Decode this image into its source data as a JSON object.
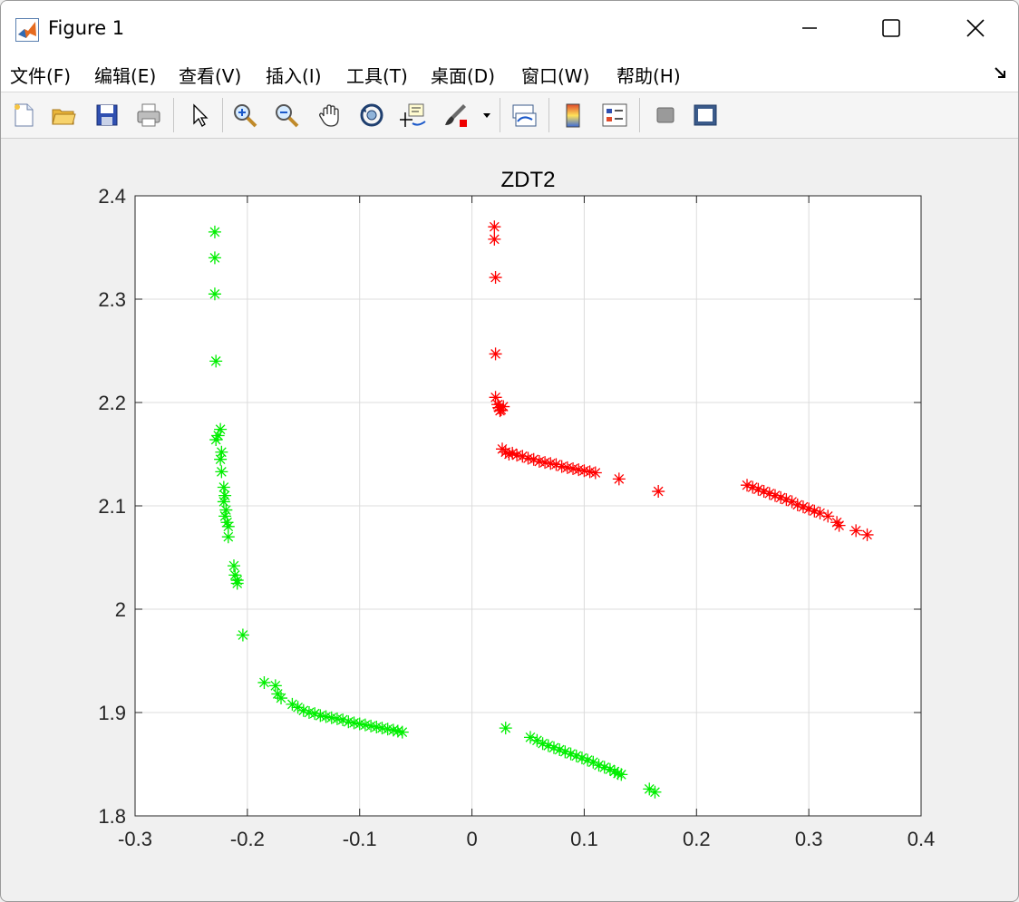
{
  "window": {
    "title": "Figure 1"
  },
  "menu": {
    "items": [
      "文件(F)",
      "编辑(E)",
      "查看(V)",
      "插入(I)",
      "工具(T)",
      "桌面(D)",
      "窗口(W)",
      "帮助(H)"
    ]
  },
  "toolbar": {
    "buttons": [
      "new-figure-icon",
      "open-file-icon",
      "save-icon",
      "print-icon",
      "select-arrow-icon",
      "zoom-in-icon",
      "zoom-out-icon",
      "pan-hand-icon",
      "rotate-3d-icon",
      "data-cursor-icon",
      "brush-icon",
      "link-plot-icon",
      "colorbar-icon",
      "legend-icon",
      "hide-plot-tools-icon",
      "show-plot-tools-icon"
    ]
  },
  "colors": {
    "series_green": "#00ee00",
    "series_red": "#ff0000"
  },
  "chart_data": {
    "type": "scatter",
    "title": "ZDT2",
    "xlabel": "",
    "ylabel": "",
    "xlim": [
      -0.3,
      0.4
    ],
    "ylim": [
      1.8,
      2.4
    ],
    "xticks": [
      "-0.3",
      "-0.2",
      "-0.1",
      "0",
      "0.1",
      "0.2",
      "0.3",
      "0.4"
    ],
    "yticks": [
      "1.8",
      "1.9",
      "2",
      "2.1",
      "2.2",
      "2.3",
      "2.4"
    ],
    "grid": true,
    "marker": "asterisk",
    "series": [
      {
        "color": "#00ee00",
        "points": [
          [
            -0.229,
            2.365
          ],
          [
            -0.229,
            2.34
          ],
          [
            -0.229,
            2.305
          ],
          [
            -0.228,
            2.24
          ],
          [
            -0.224,
            2.174
          ],
          [
            -0.226,
            2.168
          ],
          [
            -0.228,
            2.164
          ],
          [
            -0.223,
            2.152
          ],
          [
            -0.224,
            2.145
          ],
          [
            -0.223,
            2.133
          ],
          [
            -0.221,
            2.118
          ],
          [
            -0.22,
            2.11
          ],
          [
            -0.221,
            2.104
          ],
          [
            -0.219,
            2.096
          ],
          [
            -0.22,
            2.09
          ],
          [
            -0.218,
            2.084
          ],
          [
            -0.217,
            2.08
          ],
          [
            -0.217,
            2.07
          ],
          [
            -0.212,
            2.042
          ],
          [
            -0.211,
            2.033
          ],
          [
            -0.209,
            2.028
          ],
          [
            -0.209,
            2.025
          ],
          [
            -0.204,
            1.975
          ],
          [
            -0.185,
            1.929
          ],
          [
            -0.175,
            1.926
          ],
          [
            -0.173,
            1.918
          ],
          [
            -0.17,
            1.914
          ],
          [
            -0.16,
            1.908
          ],
          [
            -0.155,
            1.905
          ],
          [
            -0.15,
            1.902
          ],
          [
            -0.145,
            1.9
          ],
          [
            -0.14,
            1.899
          ],
          [
            -0.135,
            1.897
          ],
          [
            -0.13,
            1.896
          ],
          [
            -0.125,
            1.895
          ],
          [
            -0.12,
            1.894
          ],
          [
            -0.115,
            1.893
          ],
          [
            -0.11,
            1.891
          ],
          [
            -0.105,
            1.89
          ],
          [
            -0.1,
            1.889
          ],
          [
            -0.095,
            1.888
          ],
          [
            -0.09,
            1.887
          ],
          [
            -0.085,
            1.886
          ],
          [
            -0.08,
            1.885
          ],
          [
            -0.075,
            1.884
          ],
          [
            -0.07,
            1.883
          ],
          [
            -0.066,
            1.882
          ],
          [
            -0.062,
            1.881
          ],
          [
            0.03,
            1.885
          ],
          [
            0.052,
            1.876
          ],
          [
            0.058,
            1.873
          ],
          [
            0.063,
            1.87
          ],
          [
            0.068,
            1.868
          ],
          [
            0.073,
            1.866
          ],
          [
            0.078,
            1.864
          ],
          [
            0.083,
            1.862
          ],
          [
            0.088,
            1.86
          ],
          [
            0.093,
            1.858
          ],
          [
            0.098,
            1.856
          ],
          [
            0.103,
            1.854
          ],
          [
            0.108,
            1.852
          ],
          [
            0.113,
            1.849
          ],
          [
            0.118,
            1.847
          ],
          [
            0.123,
            1.845
          ],
          [
            0.127,
            1.843
          ],
          [
            0.13,
            1.841
          ],
          [
            0.133,
            1.84
          ],
          [
            0.158,
            1.826
          ],
          [
            0.163,
            1.823
          ]
        ]
      },
      {
        "color": "#ff0000",
        "points": [
          [
            0.02,
            2.37
          ],
          [
            0.02,
            2.358
          ],
          [
            0.021,
            2.321
          ],
          [
            0.021,
            2.247
          ],
          [
            0.021,
            2.205
          ],
          [
            0.023,
            2.198
          ],
          [
            0.024,
            2.195
          ],
          [
            0.026,
            2.193
          ],
          [
            0.028,
            2.196
          ],
          [
            0.025,
            2.192
          ],
          [
            0.027,
            2.155
          ],
          [
            0.03,
            2.152
          ],
          [
            0.033,
            2.15
          ],
          [
            0.036,
            2.151
          ],
          [
            0.04,
            2.149
          ],
          [
            0.045,
            2.148
          ],
          [
            0.05,
            2.146
          ],
          [
            0.055,
            2.145
          ],
          [
            0.06,
            2.143
          ],
          [
            0.065,
            2.142
          ],
          [
            0.07,
            2.141
          ],
          [
            0.075,
            2.14
          ],
          [
            0.08,
            2.138
          ],
          [
            0.085,
            2.137
          ],
          [
            0.09,
            2.136
          ],
          [
            0.095,
            2.135
          ],
          [
            0.1,
            2.134
          ],
          [
            0.105,
            2.133
          ],
          [
            0.11,
            2.132
          ],
          [
            0.131,
            2.126
          ],
          [
            0.166,
            2.114
          ],
          [
            0.245,
            2.12
          ],
          [
            0.25,
            2.118
          ],
          [
            0.255,
            2.116
          ],
          [
            0.26,
            2.114
          ],
          [
            0.265,
            2.112
          ],
          [
            0.27,
            2.11
          ],
          [
            0.275,
            2.108
          ],
          [
            0.28,
            2.106
          ],
          [
            0.285,
            2.104
          ],
          [
            0.29,
            2.101
          ],
          [
            0.295,
            2.099
          ],
          [
            0.3,
            2.097
          ],
          [
            0.305,
            2.095
          ],
          [
            0.31,
            2.093
          ],
          [
            0.317,
            2.09
          ],
          [
            0.325,
            2.084
          ],
          [
            0.327,
            2.081
          ],
          [
            0.342,
            2.076
          ],
          [
            0.352,
            2.072
          ]
        ]
      }
    ]
  }
}
